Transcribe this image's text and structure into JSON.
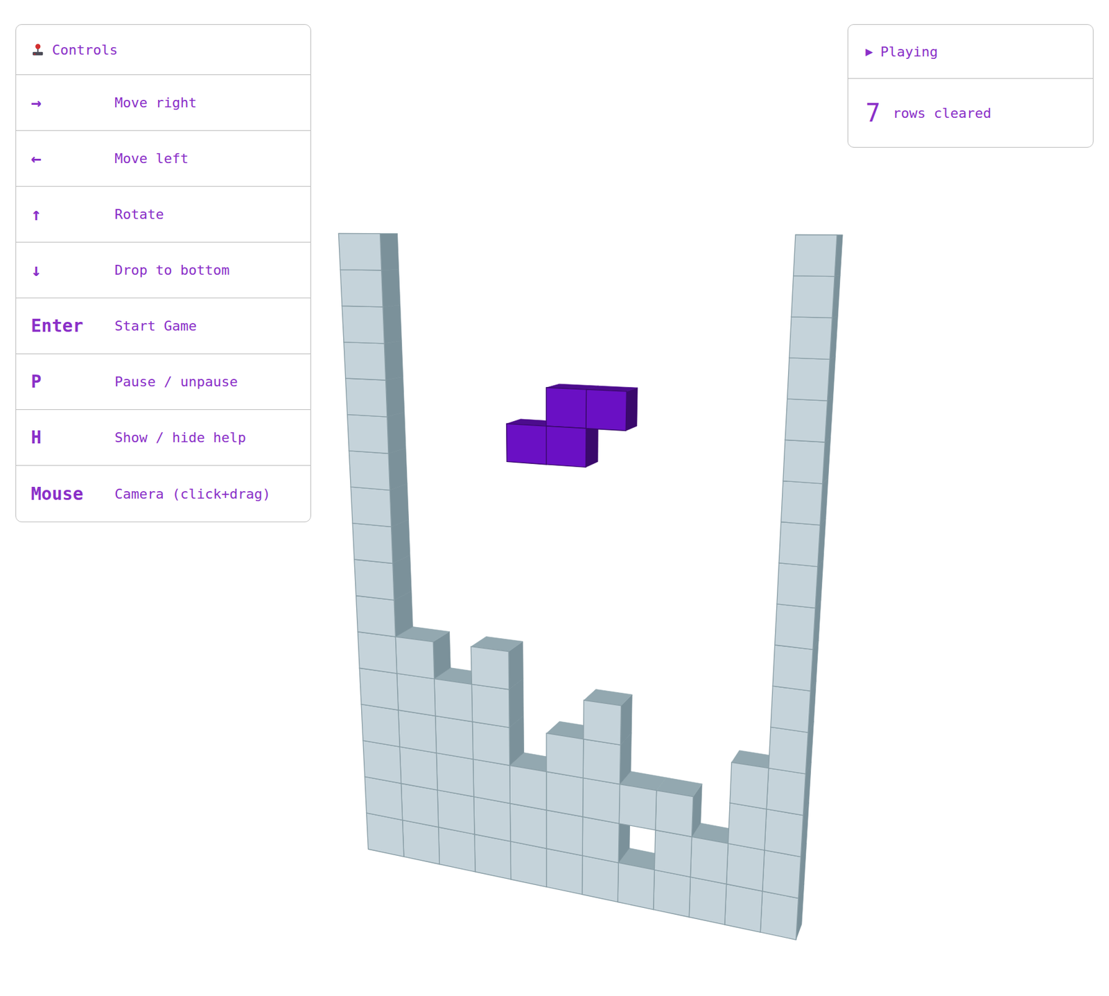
{
  "controls": {
    "title": "Controls",
    "rows": [
      {
        "key": "→",
        "label": "Move right"
      },
      {
        "key": "←",
        "label": "Move left"
      },
      {
        "key": "↑",
        "label": "Rotate"
      },
      {
        "key": "↓",
        "label": "Drop to bottom"
      },
      {
        "key": "Enter",
        "label": "Start Game"
      },
      {
        "key": "P",
        "label": "Pause / unpause"
      },
      {
        "key": "H",
        "label": "Show / hide help"
      },
      {
        "key": "Mouse",
        "label": "Camera (click+drag)"
      }
    ]
  },
  "status": {
    "icon": "▶",
    "state": "Playing",
    "count": "7",
    "count_label": "rows cleared"
  },
  "board": {
    "cells": [
      [
        1,
        1,
        1,
        1,
        1,
        1,
        0,
        1,
        1,
        1
      ],
      [
        1,
        1,
        1,
        1,
        1,
        1,
        1,
        1,
        0,
        1
      ],
      [
        1,
        1,
        1,
        0,
        1,
        1,
        0,
        0,
        0,
        1
      ],
      [
        1,
        1,
        1,
        0,
        0,
        1,
        0,
        0,
        0,
        0
      ],
      [
        1,
        0,
        1,
        0,
        0,
        0,
        0,
        0,
        0,
        0
      ],
      [
        0,
        0,
        0,
        0,
        0,
        0,
        0,
        0,
        0,
        0
      ],
      [
        0,
        0,
        0,
        0,
        0,
        0,
        0,
        0,
        0,
        0
      ],
      [
        0,
        0,
        0,
        0,
        0,
        0,
        0,
        0,
        0,
        0
      ],
      [
        0,
        0,
        0,
        0,
        0,
        0,
        0,
        0,
        0,
        0
      ],
      [
        0,
        0,
        0,
        0,
        0,
        0,
        0,
        0,
        0,
        0
      ],
      [
        0,
        0,
        0,
        0,
        0,
        0,
        0,
        0,
        0,
        0
      ],
      [
        0,
        0,
        0,
        0,
        0,
        0,
        0,
        0,
        0,
        0
      ],
      [
        0,
        0,
        0,
        0,
        0,
        0,
        0,
        0,
        0,
        0
      ],
      [
        0,
        0,
        0,
        0,
        0,
        0,
        0,
        0,
        0,
        0
      ],
      [
        0,
        0,
        0,
        0,
        0,
        0,
        0,
        0,
        0,
        0
      ],
      [
        0,
        0,
        0,
        0,
        0,
        0,
        0,
        0,
        0,
        0
      ]
    ]
  },
  "piece": {
    "color": "#6a10c4",
    "cells": [
      [
        4,
        12
      ],
      [
        5,
        12
      ],
      [
        3,
        11
      ],
      [
        4,
        11
      ]
    ]
  }
}
